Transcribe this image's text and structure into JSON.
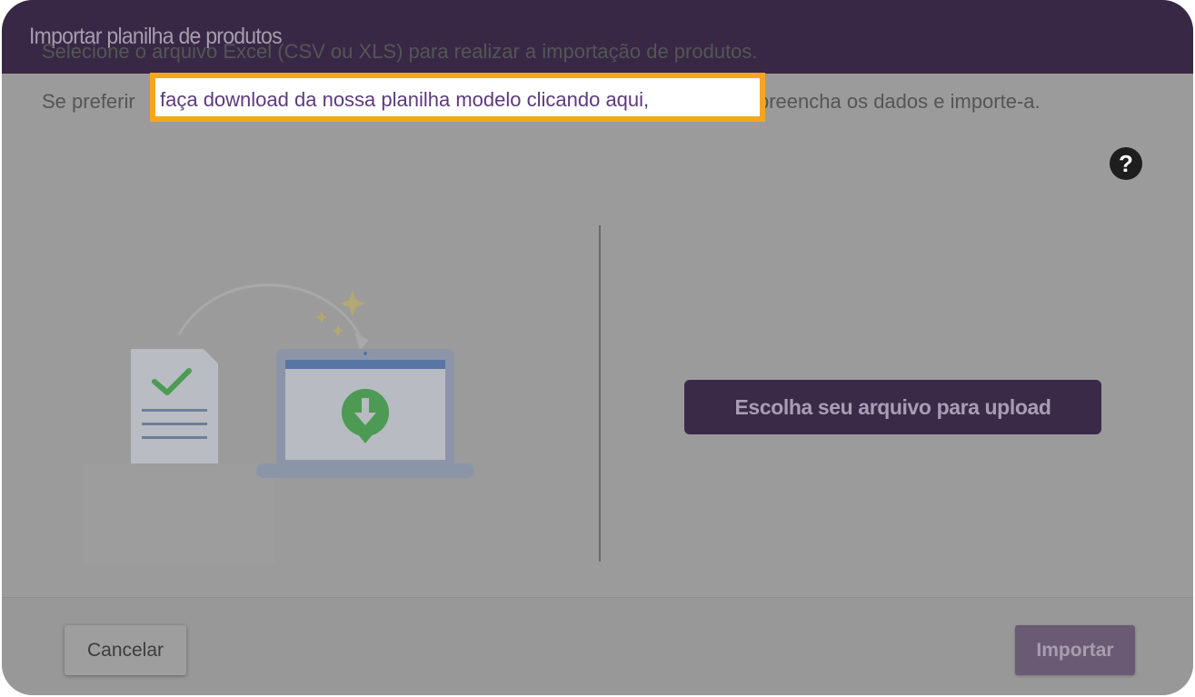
{
  "modal": {
    "title": "Importar planilha de produtos"
  },
  "instructions": {
    "line1": "Selecione o arquivo Excel (CSV ou XLS) para realizar a importação de produtos.",
    "line2_before": "Se preferir",
    "line2_link": "faça download da nossa planilha modelo clicando aqui,",
    "line2_after": "preencha os dados e importe-a."
  },
  "help_icon": {
    "glyph": "?",
    "icon": "question-circle-icon"
  },
  "upload": {
    "button_label": "Escolha seu arquivo para upload"
  },
  "footer": {
    "cancel_label": "Cancelar",
    "import_label": "Importar"
  },
  "colors": {
    "header_bg": "#382846",
    "highlight_border": "#f4a71d",
    "link_color": "#5d3a7c",
    "upload_button_bg": "#3a2a48",
    "import_button_bg": "#6a5a74"
  }
}
